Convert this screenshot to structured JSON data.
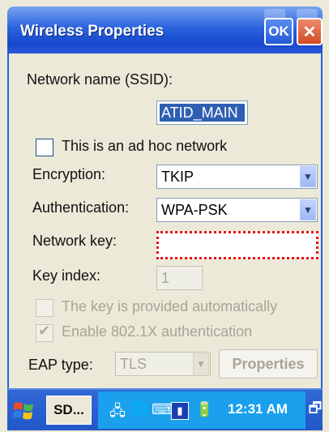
{
  "window": {
    "title": "Wireless Properties",
    "ok_label": "OK",
    "close_label": "✕"
  },
  "form": {
    "ssid_label": "Network name (SSID):",
    "ssid_value": "ATID_MAIN",
    "adhoc_label": "This is an ad hoc network",
    "adhoc_checked": false,
    "encryption_label": "Encryption:",
    "encryption_value": "TKIP",
    "authentication_label": "Authentication:",
    "authentication_value": "WPA-PSK",
    "network_key_label": "Network key:",
    "network_key_value": "",
    "key_index_label": "Key index:",
    "key_index_value": "1",
    "auto_key_label": "The key is provided automatically",
    "auto_key_checked": false,
    "enable_8021x_label": "Enable 802.1X authentication",
    "enable_8021x_checked": true,
    "eap_type_label": "EAP type:",
    "eap_type_value": "TLS",
    "properties_button": "Properties"
  },
  "taskbar": {
    "sd_button": "SD...",
    "clock": "12:31 AM"
  },
  "colors": {
    "titlebar": "#2b63dd",
    "highlight_border": "#e31010",
    "selection": "#2f5fb3"
  }
}
